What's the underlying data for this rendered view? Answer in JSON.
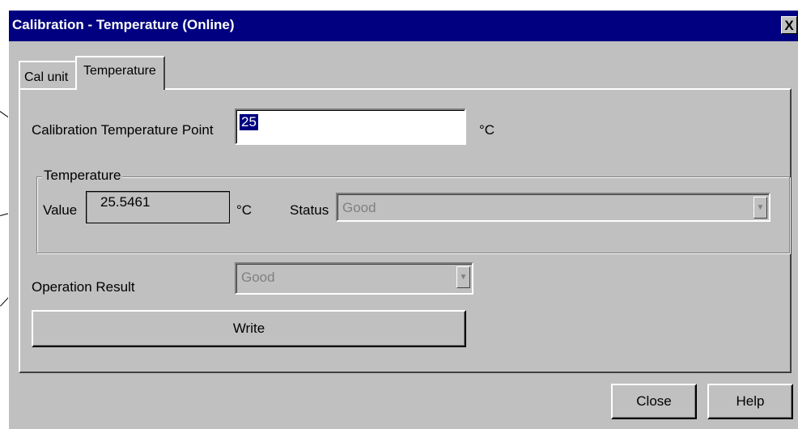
{
  "window": {
    "title": "Calibration - Temperature  (Online)",
    "close_glyph": "X"
  },
  "tabs": [
    {
      "label": "Cal unit",
      "active": false
    },
    {
      "label": "Temperature",
      "active": true
    }
  ],
  "calibration_point": {
    "label": "Calibration Temperature Point",
    "value": "25",
    "unit": "°C"
  },
  "temperature_group": {
    "legend": "Temperature",
    "value_label": "Value",
    "value": "25.5461",
    "unit": "°C",
    "status_label": "Status",
    "status_value": "Good"
  },
  "operation_result": {
    "label": "Operation Result",
    "value": "Good"
  },
  "buttons": {
    "write": "Write",
    "close": "Close",
    "help": "Help"
  },
  "icons": {
    "dropdown_arrow": "▼"
  },
  "colors": {
    "titlebar": "#000080",
    "face": "#c0c0c0",
    "selection": "#000080",
    "disabled_text": "#808080"
  }
}
